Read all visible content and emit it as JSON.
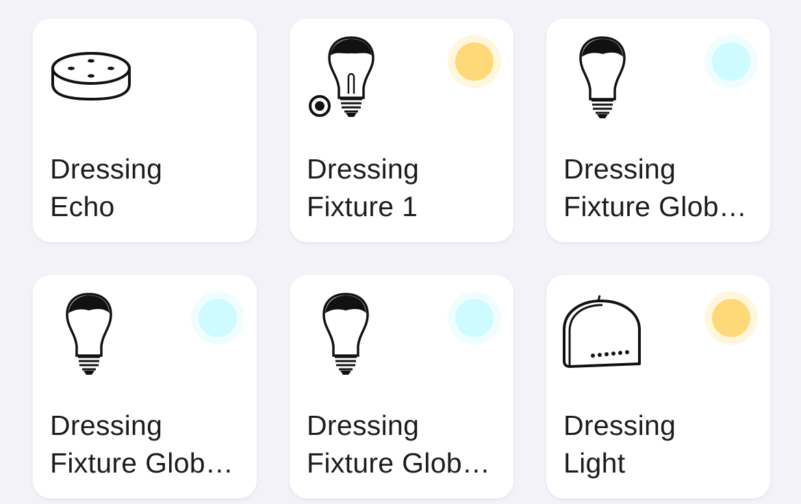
{
  "devices": [
    {
      "line1": "Dressing",
      "line2": "Echo",
      "icon": "echo-dot-speaker-icon",
      "status_color": null
    },
    {
      "line1": "Dressing",
      "line2": "Fixture 1",
      "icon": "bulb-with-button-icon",
      "status_color": "#ffd978"
    },
    {
      "line1": "Dressing",
      "line2": "Fixture Glob…",
      "icon": "light-bulb-icon",
      "status_color": "#cdfbff"
    },
    {
      "line1": "Dressing",
      "line2": "Fixture Glob…",
      "icon": "light-bulb-icon",
      "status_color": "#cdfbff"
    },
    {
      "line1": "Dressing",
      "line2": "Fixture Glob…",
      "icon": "light-bulb-icon",
      "status_color": "#cdfbff"
    },
    {
      "line1": "Dressing",
      "line2": "Light",
      "icon": "relay-module-icon",
      "status_color": "#ffd978"
    }
  ]
}
